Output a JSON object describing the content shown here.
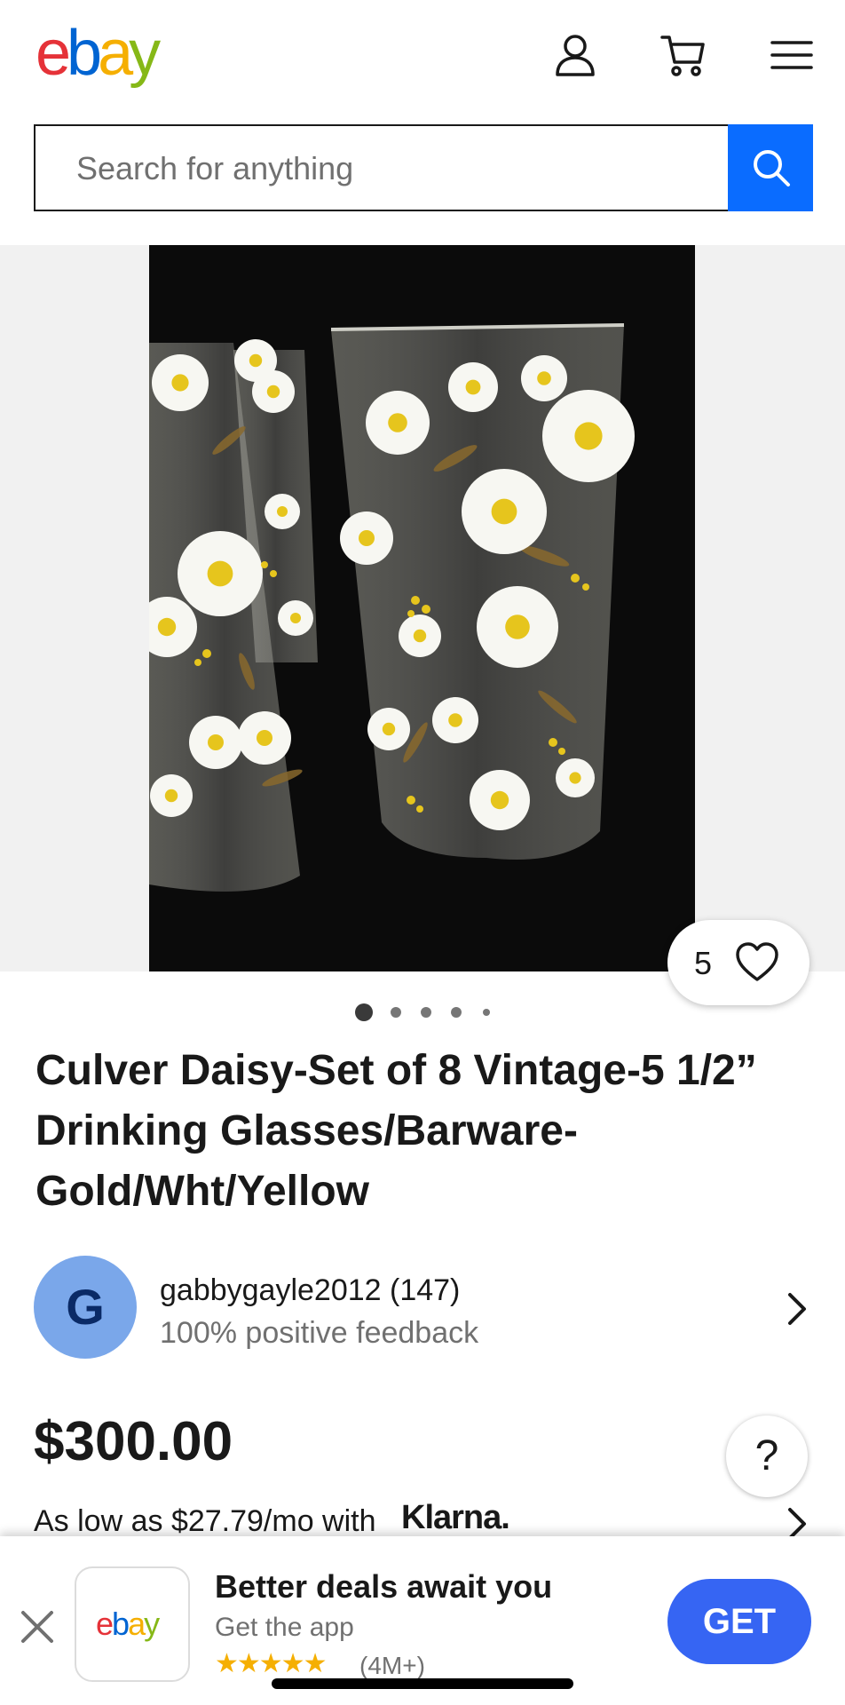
{
  "header": {
    "logo": {
      "e": "e",
      "b": "b",
      "a": "a",
      "y": "y"
    },
    "icons": [
      "account-icon",
      "cart-icon",
      "menu-icon"
    ]
  },
  "search": {
    "placeholder": "Search for anything",
    "button_icon": "search-icon"
  },
  "gallery": {
    "watch_count": "5",
    "dot_count": 5,
    "active_dot": 1
  },
  "listing": {
    "title": "Culver Daisy-Set of 8 Vintage-5 1/2” Drinking Glasses/Barware-Gold/Wht/Yellow",
    "seller": {
      "initial": "G",
      "name": "gabbygayle2012 (147)",
      "feedback": "100% positive feedback"
    },
    "price": "$300.00",
    "financing": {
      "text": "As low as $27.79/mo with",
      "provider": "Klarna."
    },
    "help": "?"
  },
  "app_banner": {
    "logo": {
      "e": "e",
      "b": "b",
      "a": "a",
      "y": "y"
    },
    "title": "Better deals await you",
    "subtitle": "Get the app",
    "stars": "★★★★★",
    "rating_count": "(4M+)",
    "get_label": "GET"
  },
  "colors": {
    "ebay_red": "#e53238",
    "ebay_blue": "#0064d2",
    "ebay_yellow": "#f5af02",
    "ebay_green": "#86b817",
    "search_button": "#0a6cff",
    "get_button": "#3665f3"
  }
}
